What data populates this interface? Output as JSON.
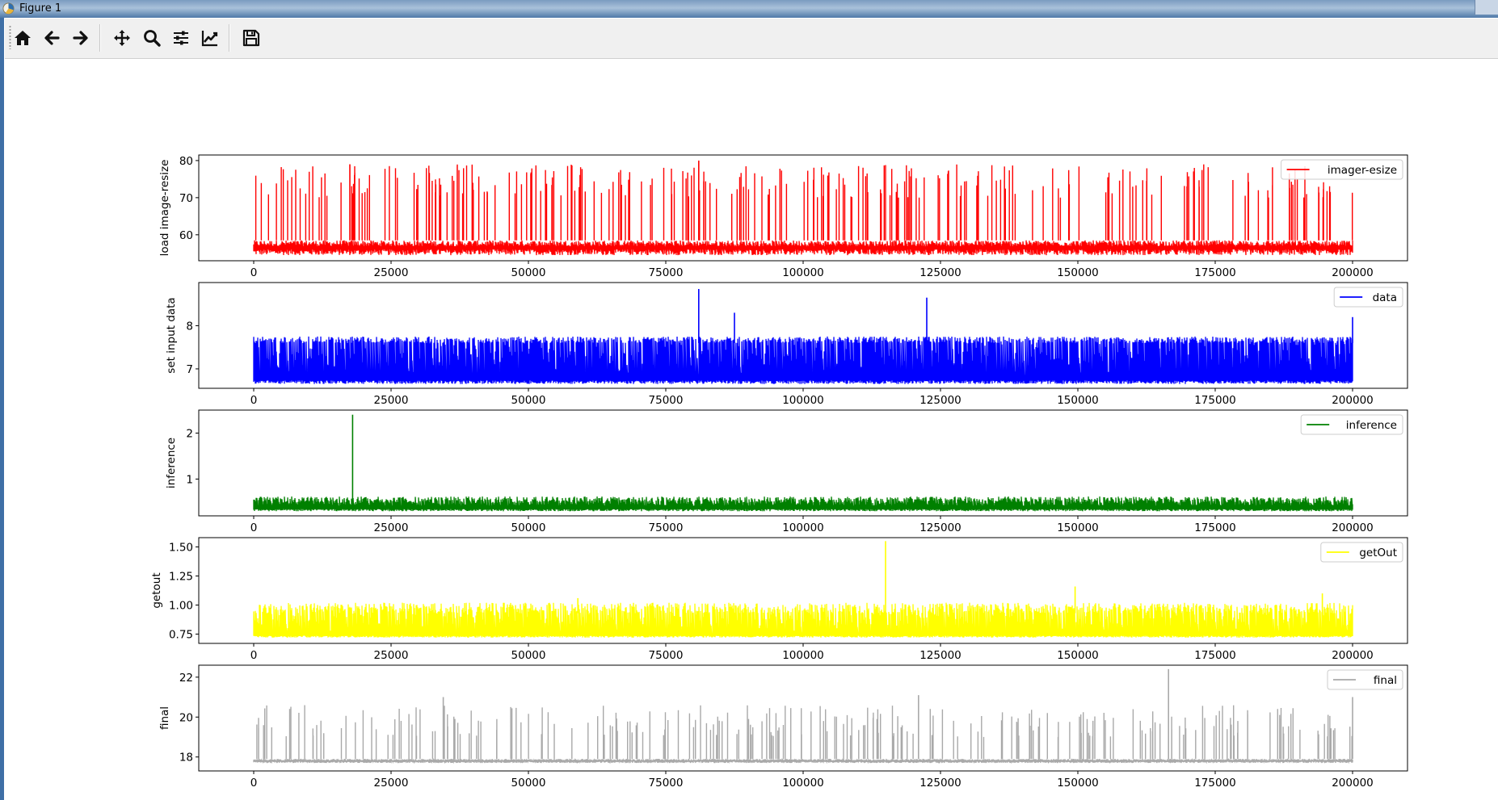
{
  "window": {
    "title": "Figure 1"
  },
  "toolbar": {
    "buttons": [
      {
        "name": "home-button",
        "icon": "home-icon",
        "tooltip": ""
      },
      {
        "name": "back-button",
        "icon": "arrow-left-icon",
        "tooltip": ""
      },
      {
        "name": "forward-button",
        "icon": "arrow-right-icon",
        "tooltip": ""
      },
      {
        "name": "pan-button",
        "icon": "move-icon",
        "tooltip": ""
      },
      {
        "name": "zoom-button",
        "icon": "search-icon",
        "tooltip": ""
      },
      {
        "name": "configure-subplots-button",
        "icon": "sliders-icon",
        "tooltip": ""
      },
      {
        "name": "edit-axis-button",
        "icon": "line-chart-icon",
        "tooltip": ""
      },
      {
        "name": "save-button",
        "icon": "floppy-disk-icon",
        "tooltip": ""
      }
    ]
  },
  "chart_data": [
    {
      "type": "line",
      "ylabel": "load image-resize",
      "legend": "imager-esize",
      "legend_position": "upper right",
      "color": "#ff0000",
      "xlim": [
        -10000,
        210000
      ],
      "ylim": [
        53,
        81.5
      ],
      "x_ticks": [
        0,
        25000,
        50000,
        75000,
        100000,
        125000,
        150000,
        175000,
        200000
      ],
      "y_ticks": [
        60,
        70,
        80
      ],
      "x_tick_labels": [
        "0",
        "25000",
        "50000",
        "75000",
        "100000",
        "125000",
        "150000",
        "175000",
        "200000"
      ],
      "y_tick_labels": [
        "60",
        "70",
        "80"
      ],
      "baseline": [
        54.5,
        58.5
      ],
      "spike_range": [
        70,
        79
      ],
      "spike_count": 260,
      "n_points": 200000,
      "notable_peaks": [
        [
          81000,
          80
        ],
        [
          17500,
          79
        ]
      ]
    },
    {
      "type": "line",
      "ylabel": "set input data",
      "legend": "data",
      "legend_position": "upper right",
      "color": "#0000ff",
      "xlim": [
        -10000,
        210000
      ],
      "ylim": [
        6.55,
        9.0
      ],
      "x_ticks": [
        0,
        25000,
        50000,
        75000,
        100000,
        125000,
        150000,
        175000,
        200000
      ],
      "y_ticks": [
        7,
        8
      ],
      "x_tick_labels": [
        "0",
        "25000",
        "50000",
        "75000",
        "100000",
        "125000",
        "150000",
        "175000",
        "200000"
      ],
      "y_tick_labels": [
        "7",
        "8"
      ],
      "baseline": [
        6.65,
        6.85
      ],
      "band_top": [
        7.6,
        7.75
      ],
      "spike_range": [
        7.9,
        8.3
      ],
      "n_points": 200000,
      "notable_peaks": [
        [
          81000,
          8.85
        ],
        [
          122500,
          8.65
        ],
        [
          87500,
          8.3
        ],
        [
          200000,
          8.2
        ]
      ]
    },
    {
      "type": "line",
      "ylabel": "inference",
      "legend": "inference",
      "legend_position": "upper right",
      "color": "#008000",
      "xlim": [
        -10000,
        210000
      ],
      "ylim": [
        0.2,
        2.5
      ],
      "x_ticks": [
        0,
        25000,
        50000,
        75000,
        100000,
        125000,
        150000,
        175000,
        200000
      ],
      "y_ticks": [
        1,
        2
      ],
      "x_tick_labels": [
        "0",
        "25000",
        "50000",
        "75000",
        "100000",
        "125000",
        "150000",
        "175000",
        "200000"
      ],
      "y_tick_labels": [
        "1",
        "2"
      ],
      "baseline": [
        0.3,
        0.42
      ],
      "band_top": [
        0.5,
        0.62
      ],
      "n_points": 200000,
      "notable_peaks": [
        [
          18000,
          2.4
        ]
      ]
    },
    {
      "type": "line",
      "ylabel": "getout",
      "legend": "getOut",
      "legend_position": "upper right",
      "color": "#ffff00",
      "xlim": [
        -10000,
        210000
      ],
      "ylim": [
        0.67,
        1.58
      ],
      "x_ticks": [
        0,
        25000,
        50000,
        75000,
        100000,
        125000,
        150000,
        175000,
        200000
      ],
      "y_ticks": [
        0.75,
        1.0,
        1.25,
        1.5
      ],
      "x_tick_labels": [
        "0",
        "25000",
        "50000",
        "75000",
        "100000",
        "125000",
        "150000",
        "175000",
        "200000"
      ],
      "y_tick_labels": [
        "0.75",
        "1.00",
        "1.25",
        "1.50"
      ],
      "baseline": [
        0.72,
        0.76
      ],
      "band_top": [
        0.93,
        1.02
      ],
      "n_points": 200000,
      "notable_peaks": [
        [
          115000,
          1.55
        ],
        [
          149500,
          1.16
        ],
        [
          194500,
          1.1
        ],
        [
          59000,
          1.06
        ]
      ]
    },
    {
      "type": "line",
      "ylabel": "final",
      "legend": "final",
      "legend_position": "upper right",
      "color": "#a9a9a9",
      "xlim": [
        -10000,
        210000
      ],
      "ylim": [
        17.3,
        22.6
      ],
      "x_ticks": [
        0,
        25000,
        50000,
        75000,
        100000,
        125000,
        150000,
        175000,
        200000
      ],
      "y_ticks": [
        18,
        20,
        22
      ],
      "x_tick_labels": [
        "0",
        "25000",
        "50000",
        "75000",
        "100000",
        "125000",
        "150000",
        "175000",
        "200000"
      ],
      "y_tick_labels": [
        "18",
        "20",
        "22"
      ],
      "baseline": [
        17.7,
        17.9
      ],
      "spike_range": [
        19.0,
        20.6
      ],
      "spike_count": 240,
      "n_points": 200000,
      "notable_peaks": [
        [
          166500,
          22.4
        ],
        [
          34500,
          21.0
        ],
        [
          200000,
          21.0
        ],
        [
          121000,
          21.1
        ]
      ]
    }
  ]
}
